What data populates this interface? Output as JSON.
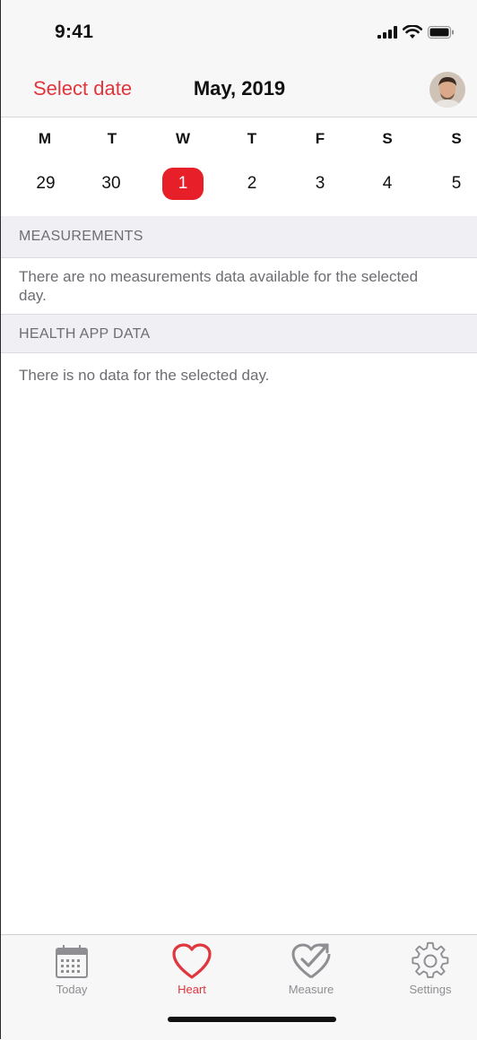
{
  "status_bar": {
    "time": "9:41"
  },
  "nav": {
    "select_date": "Select date",
    "title": "May, 2019"
  },
  "calendar": {
    "weekdays": [
      "M",
      "T",
      "W",
      "T",
      "F",
      "S",
      "S"
    ],
    "days": [
      "29",
      "30",
      "1",
      "2",
      "3",
      "4",
      "5"
    ],
    "selected_day": "1"
  },
  "sections": {
    "measurements": {
      "header": "MEASUREMENTS",
      "message": "There are no measurements data available for the selected day."
    },
    "health": {
      "header": "HEALTH APP DATA",
      "message": "There is no data for the selected day."
    }
  },
  "tabs": [
    {
      "label": "Today",
      "icon": "calendar-icon"
    },
    {
      "label": "Heart",
      "icon": "heart-icon",
      "active": true
    },
    {
      "label": "Measure",
      "icon": "heart-check-icon"
    },
    {
      "label": "Settings",
      "icon": "gear-icon"
    }
  ],
  "colors": {
    "accent": "#e0363d",
    "selected_day_bg": "#e61f29",
    "section_header_bg": "#efeff4",
    "secondary_text": "#6d6d72"
  }
}
